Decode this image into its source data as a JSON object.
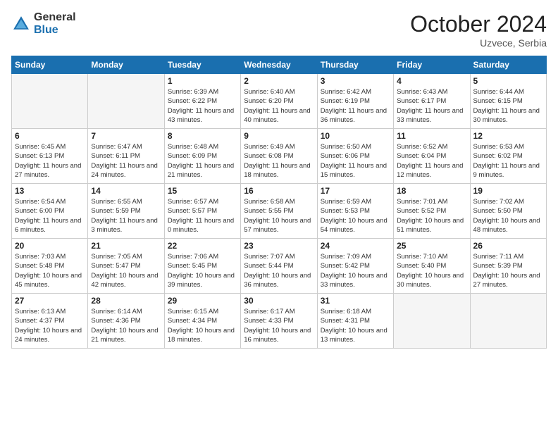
{
  "header": {
    "logo_general": "General",
    "logo_blue": "Blue",
    "month_title": "October 2024",
    "location": "Uzvece, Serbia"
  },
  "days_of_week": [
    "Sunday",
    "Monday",
    "Tuesday",
    "Wednesday",
    "Thursday",
    "Friday",
    "Saturday"
  ],
  "weeks": [
    [
      {
        "day": "",
        "empty": true
      },
      {
        "day": "",
        "empty": true
      },
      {
        "day": "1",
        "sunrise": "Sunrise: 6:39 AM",
        "sunset": "Sunset: 6:22 PM",
        "daylight": "Daylight: 11 hours and 43 minutes."
      },
      {
        "day": "2",
        "sunrise": "Sunrise: 6:40 AM",
        "sunset": "Sunset: 6:20 PM",
        "daylight": "Daylight: 11 hours and 40 minutes."
      },
      {
        "day": "3",
        "sunrise": "Sunrise: 6:42 AM",
        "sunset": "Sunset: 6:19 PM",
        "daylight": "Daylight: 11 hours and 36 minutes."
      },
      {
        "day": "4",
        "sunrise": "Sunrise: 6:43 AM",
        "sunset": "Sunset: 6:17 PM",
        "daylight": "Daylight: 11 hours and 33 minutes."
      },
      {
        "day": "5",
        "sunrise": "Sunrise: 6:44 AM",
        "sunset": "Sunset: 6:15 PM",
        "daylight": "Daylight: 11 hours and 30 minutes."
      }
    ],
    [
      {
        "day": "6",
        "sunrise": "Sunrise: 6:45 AM",
        "sunset": "Sunset: 6:13 PM",
        "daylight": "Daylight: 11 hours and 27 minutes."
      },
      {
        "day": "7",
        "sunrise": "Sunrise: 6:47 AM",
        "sunset": "Sunset: 6:11 PM",
        "daylight": "Daylight: 11 hours and 24 minutes."
      },
      {
        "day": "8",
        "sunrise": "Sunrise: 6:48 AM",
        "sunset": "Sunset: 6:09 PM",
        "daylight": "Daylight: 11 hours and 21 minutes."
      },
      {
        "day": "9",
        "sunrise": "Sunrise: 6:49 AM",
        "sunset": "Sunset: 6:08 PM",
        "daylight": "Daylight: 11 hours and 18 minutes."
      },
      {
        "day": "10",
        "sunrise": "Sunrise: 6:50 AM",
        "sunset": "Sunset: 6:06 PM",
        "daylight": "Daylight: 11 hours and 15 minutes."
      },
      {
        "day": "11",
        "sunrise": "Sunrise: 6:52 AM",
        "sunset": "Sunset: 6:04 PM",
        "daylight": "Daylight: 11 hours and 12 minutes."
      },
      {
        "day": "12",
        "sunrise": "Sunrise: 6:53 AM",
        "sunset": "Sunset: 6:02 PM",
        "daylight": "Daylight: 11 hours and 9 minutes."
      }
    ],
    [
      {
        "day": "13",
        "sunrise": "Sunrise: 6:54 AM",
        "sunset": "Sunset: 6:00 PM",
        "daylight": "Daylight: 11 hours and 6 minutes."
      },
      {
        "day": "14",
        "sunrise": "Sunrise: 6:55 AM",
        "sunset": "Sunset: 5:59 PM",
        "daylight": "Daylight: 11 hours and 3 minutes."
      },
      {
        "day": "15",
        "sunrise": "Sunrise: 6:57 AM",
        "sunset": "Sunset: 5:57 PM",
        "daylight": "Daylight: 11 hours and 0 minutes."
      },
      {
        "day": "16",
        "sunrise": "Sunrise: 6:58 AM",
        "sunset": "Sunset: 5:55 PM",
        "daylight": "Daylight: 10 hours and 57 minutes."
      },
      {
        "day": "17",
        "sunrise": "Sunrise: 6:59 AM",
        "sunset": "Sunset: 5:53 PM",
        "daylight": "Daylight: 10 hours and 54 minutes."
      },
      {
        "day": "18",
        "sunrise": "Sunrise: 7:01 AM",
        "sunset": "Sunset: 5:52 PM",
        "daylight": "Daylight: 10 hours and 51 minutes."
      },
      {
        "day": "19",
        "sunrise": "Sunrise: 7:02 AM",
        "sunset": "Sunset: 5:50 PM",
        "daylight": "Daylight: 10 hours and 48 minutes."
      }
    ],
    [
      {
        "day": "20",
        "sunrise": "Sunrise: 7:03 AM",
        "sunset": "Sunset: 5:48 PM",
        "daylight": "Daylight: 10 hours and 45 minutes."
      },
      {
        "day": "21",
        "sunrise": "Sunrise: 7:05 AM",
        "sunset": "Sunset: 5:47 PM",
        "daylight": "Daylight: 10 hours and 42 minutes."
      },
      {
        "day": "22",
        "sunrise": "Sunrise: 7:06 AM",
        "sunset": "Sunset: 5:45 PM",
        "daylight": "Daylight: 10 hours and 39 minutes."
      },
      {
        "day": "23",
        "sunrise": "Sunrise: 7:07 AM",
        "sunset": "Sunset: 5:44 PM",
        "daylight": "Daylight: 10 hours and 36 minutes."
      },
      {
        "day": "24",
        "sunrise": "Sunrise: 7:09 AM",
        "sunset": "Sunset: 5:42 PM",
        "daylight": "Daylight: 10 hours and 33 minutes."
      },
      {
        "day": "25",
        "sunrise": "Sunrise: 7:10 AM",
        "sunset": "Sunset: 5:40 PM",
        "daylight": "Daylight: 10 hours and 30 minutes."
      },
      {
        "day": "26",
        "sunrise": "Sunrise: 7:11 AM",
        "sunset": "Sunset: 5:39 PM",
        "daylight": "Daylight: 10 hours and 27 minutes."
      }
    ],
    [
      {
        "day": "27",
        "sunrise": "Sunrise: 6:13 AM",
        "sunset": "Sunset: 4:37 PM",
        "daylight": "Daylight: 10 hours and 24 minutes."
      },
      {
        "day": "28",
        "sunrise": "Sunrise: 6:14 AM",
        "sunset": "Sunset: 4:36 PM",
        "daylight": "Daylight: 10 hours and 21 minutes."
      },
      {
        "day": "29",
        "sunrise": "Sunrise: 6:15 AM",
        "sunset": "Sunset: 4:34 PM",
        "daylight": "Daylight: 10 hours and 18 minutes."
      },
      {
        "day": "30",
        "sunrise": "Sunrise: 6:17 AM",
        "sunset": "Sunset: 4:33 PM",
        "daylight": "Daylight: 10 hours and 16 minutes."
      },
      {
        "day": "31",
        "sunrise": "Sunrise: 6:18 AM",
        "sunset": "Sunset: 4:31 PM",
        "daylight": "Daylight: 10 hours and 13 minutes."
      },
      {
        "day": "",
        "empty": true
      },
      {
        "day": "",
        "empty": true
      }
    ]
  ]
}
